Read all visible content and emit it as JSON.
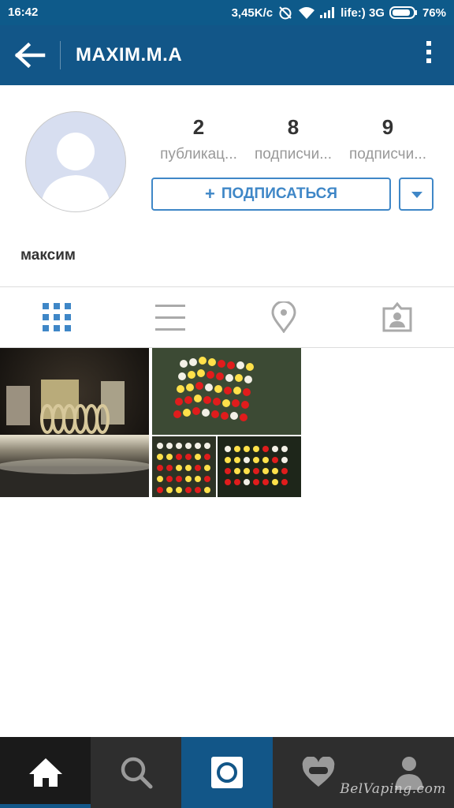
{
  "status_bar": {
    "time": "16:42",
    "speed": "3,45K/c",
    "carrier": "life:) 3G",
    "battery": "76%"
  },
  "app_bar": {
    "title": "MAXIM.M.A",
    "back_icon": "arrow-left-icon",
    "menu_icon": "kebab-menu-icon"
  },
  "profile": {
    "avatar_icon": "default-avatar-icon",
    "stats": [
      {
        "value": "2",
        "label": "публикац..."
      },
      {
        "value": "8",
        "label": "подписчи..."
      },
      {
        "value": "9",
        "label": "подписчи..."
      }
    ],
    "follow_button": {
      "plus": "+",
      "label": "ПОДПИСАТЬСЯ"
    },
    "dropdown_icon": "caret-down-icon",
    "full_name": "максим"
  },
  "tabs": [
    {
      "icon": "grid-view-icon",
      "active": true
    },
    {
      "icon": "list-view-icon",
      "active": false
    },
    {
      "icon": "location-pin-icon",
      "active": false
    },
    {
      "icon": "tagged-photos-icon",
      "active": false
    }
  ],
  "posts": [
    {
      "icon": "vape-coil-photo"
    },
    {
      "icon": "eliquid-bottles-photo"
    }
  ],
  "bottom_nav": [
    {
      "icon": "home-icon",
      "active": true
    },
    {
      "icon": "search-icon",
      "active": false
    },
    {
      "icon": "camera-icon",
      "active": false
    },
    {
      "icon": "heart-icon",
      "active": false
    },
    {
      "icon": "profile-icon",
      "active": false
    }
  ],
  "watermark": "BelVaping.com",
  "colors": {
    "status_bar": "#0e5a8a",
    "app_bar": "#125688",
    "accent": "#3f87c7",
    "nav_bg": "#2e2e2e"
  }
}
